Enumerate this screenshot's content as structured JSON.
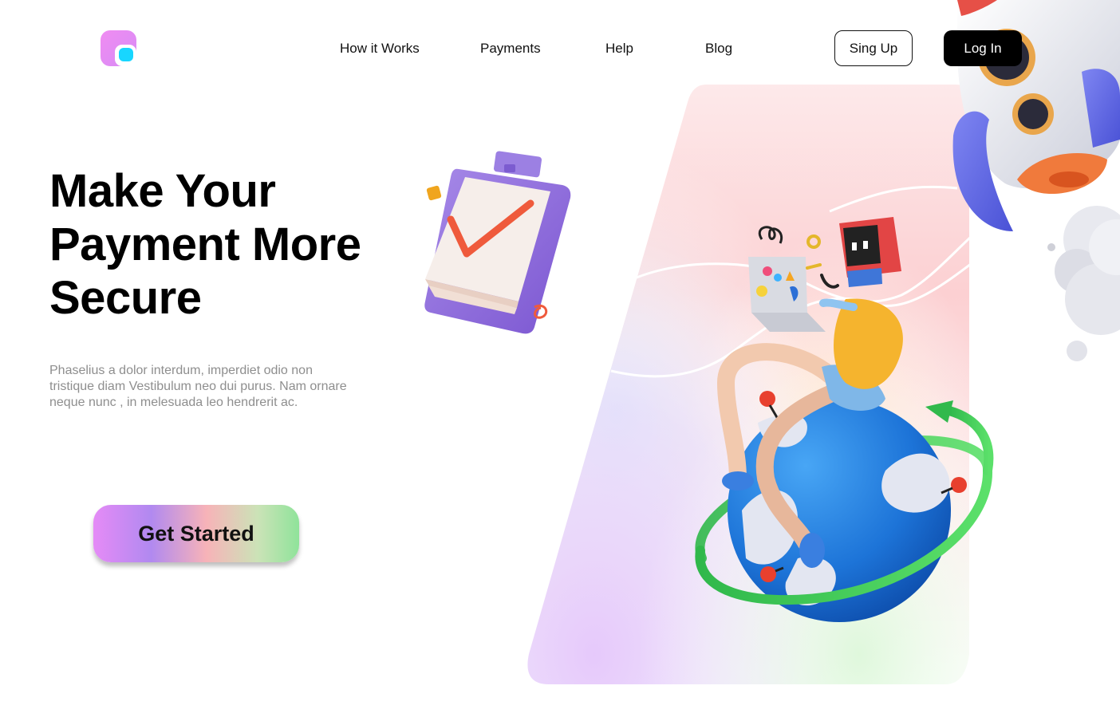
{
  "header": {
    "logo_icon": "app-logo-icon",
    "nav": [
      {
        "label": "How it Works"
      },
      {
        "label": "Payments"
      },
      {
        "label": "Help"
      },
      {
        "label": "Blog"
      }
    ],
    "signup_label": "Sing Up",
    "login_label": "Log In"
  },
  "hero": {
    "title": "Make Your Payment More Secure",
    "description": "Phaselius a dolor interdum, imperdiet odio non tristique diam Vestibulum neo dui purus. Nam ornare neque nunc , in melesuada leo hendrerit ac.",
    "cta_label": "Get Started"
  },
  "illustrations": {
    "clipboard": "clipboard-check-icon",
    "globe": "globe-with-character-illustration",
    "rocket": "rocket-illustration"
  },
  "colors": {
    "logo_primary": "#f08cf2",
    "logo_accent": "#18d6ff",
    "cta_start": "#e58bf6",
    "cta_end": "#8fe39a",
    "login_bg": "#000000"
  }
}
